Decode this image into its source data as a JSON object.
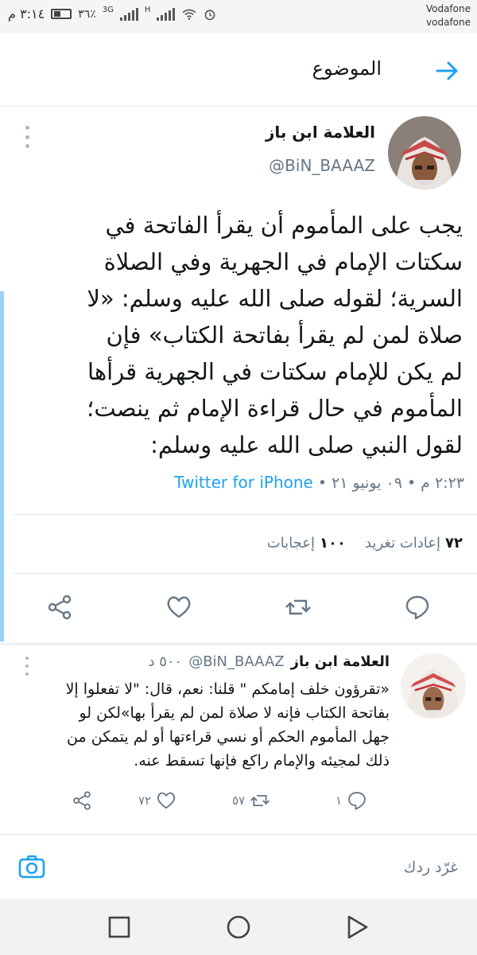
{
  "status_bar": {
    "time": "٣:١٤ م",
    "battery_pct": "٣٦٪",
    "network": "3G",
    "network2": "H",
    "carrier_line1": "Vodafone",
    "carrier_line2": "vodafone"
  },
  "header": {
    "title": "الموضوع",
    "back_icon": "arrow-right-icon"
  },
  "tweet": {
    "author_name": "العلامة ابن باز",
    "author_handle": "@BiN_BAAAZ",
    "text": "يجب على المأموم أن يقرأ الفاتحة في\nسكتات الإمام في الجهرية وفي الصلاة\nالسرية؛ لقوله صلى الله عليه وسلم: «لا\nصلاة لمن لم يقرأ بفاتحة الكتاب» فإن\nلم يكن للإمام سكتات في الجهرية قرأها\nالمأموم في حال قراءة الإمام ثم ينصت؛\nلقول النبي صلى الله عليه وسلم:",
    "time": "٢:٢٣ م",
    "date": "٠٩ يونيو ٢١",
    "separator": "•",
    "source": "Twitter for iPhone",
    "retweets_count": "٧٢",
    "retweets_label": "إعادات تغريد",
    "likes_count": "١٠٠",
    "likes_label": "إعجابات"
  },
  "reply": {
    "author_name": "العلامة ابن باز",
    "author_handle": "@BiN_BAAAZ",
    "time_ago": "٥٠٠ د",
    "text": "«تقرؤون خلف إمامكم \" قلنا: نعم، قال: \"لا تفعلوا إلا\nبفاتحة الكتاب فإنه لا صلاة لمن لم يقرأ بها»لكن لو\nجهل المأموم الحكم أو نسي قراءتها أو لم يتمكن من\nذلك لمجيئه والإمام راكع فإنها تسقط عنه.",
    "reply_count": "١",
    "retweet_count": "٥٧",
    "like_count": "٧٢"
  },
  "compose": {
    "placeholder": "غرّد ردك"
  },
  "colors": {
    "accent": "#1da1f2",
    "thread_line": "#9ad2f7",
    "secondary_text": "#657786",
    "divider": "#e1e8ed"
  }
}
